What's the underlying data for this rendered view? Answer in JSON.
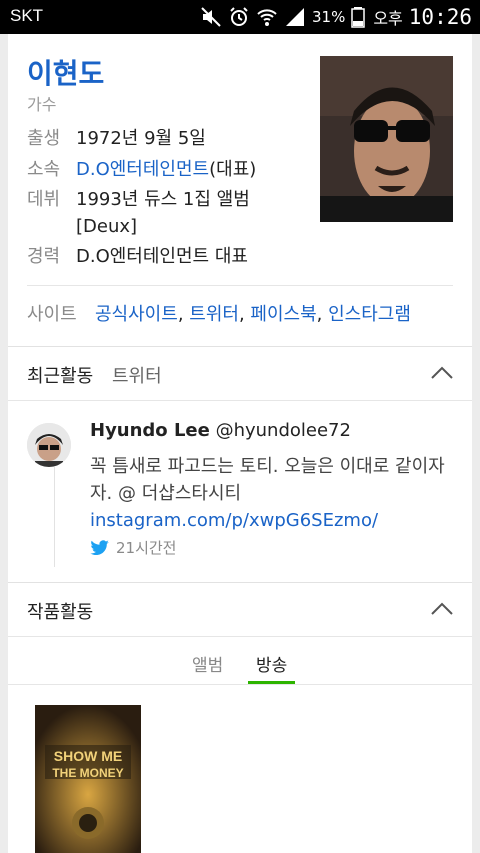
{
  "status_bar": {
    "carrier": "SKT",
    "battery_percent": "31%",
    "ampm": "오후",
    "time": "10:26"
  },
  "profile": {
    "name": "이현도",
    "job": "가수",
    "birth_label": "출생",
    "birth_value": "1972년 9월 5일",
    "agency_label": "소속",
    "agency_link": "D.O엔터테인먼트",
    "agency_suffix": "(대표)",
    "debut_label": "데뷔",
    "debut_line1": "1993년 듀스 1집 앨범",
    "debut_line2": "[Deux]",
    "career_label": "경력",
    "career_value": "D.O엔터테인먼트 대표",
    "site_label": "사이트",
    "sites": {
      "official": "공식사이트",
      "twitter": "트위터",
      "facebook": "페이스북",
      "instagram": "인스타그램",
      "sep": ", "
    }
  },
  "recent": {
    "title": "최근활동",
    "source": "트위터",
    "tweet": {
      "name": "Hyundo Lee",
      "handle": "@hyundolee72",
      "text_plain": "꼭 틈새로 파고드는 토티. 오늘은 이대로 같이자자. @ 더샵스타시티 ",
      "text_link": "instagram.com/p/xwpG6SEzmo/",
      "time": "21시간전"
    }
  },
  "works": {
    "title": "작품활동",
    "tabs": [
      "앨범",
      "방송"
    ],
    "active_tab": "방송",
    "poster_text": "SHOW ME THE MONEY"
  },
  "colors": {
    "link": "#1a63c7",
    "tab_active": "#2db400",
    "twitter": "#1da1f2"
  }
}
